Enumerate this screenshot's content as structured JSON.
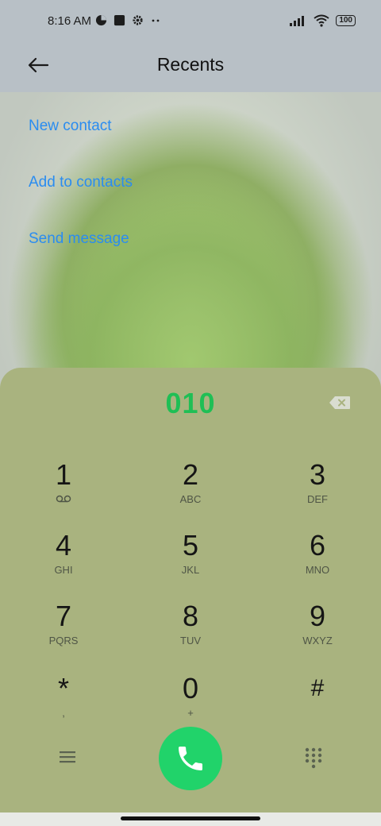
{
  "status_bar": {
    "time": "8:16 AM",
    "battery": "100"
  },
  "header": {
    "title": "Recents"
  },
  "actions": {
    "new_contact": "New contact",
    "add_to_contacts": "Add to contacts",
    "send_message": "Send message"
  },
  "dialer": {
    "number": "010",
    "keys": [
      {
        "digit": "1",
        "letters": ""
      },
      {
        "digit": "2",
        "letters": "ABC"
      },
      {
        "digit": "3",
        "letters": "DEF"
      },
      {
        "digit": "4",
        "letters": "GHI"
      },
      {
        "digit": "5",
        "letters": "JKL"
      },
      {
        "digit": "6",
        "letters": "MNO"
      },
      {
        "digit": "7",
        "letters": "PQRS"
      },
      {
        "digit": "8",
        "letters": "TUV"
      },
      {
        "digit": "9",
        "letters": "WXYZ"
      },
      {
        "digit": "*",
        "letters": ","
      },
      {
        "digit": "0",
        "letters": "+"
      },
      {
        "digit": "#",
        "letters": ""
      }
    ]
  },
  "colors": {
    "accent_blue": "#2a8cf0",
    "number_green": "#1fbf55",
    "call_green": "#21d36a",
    "panel": "#a9b37f"
  }
}
